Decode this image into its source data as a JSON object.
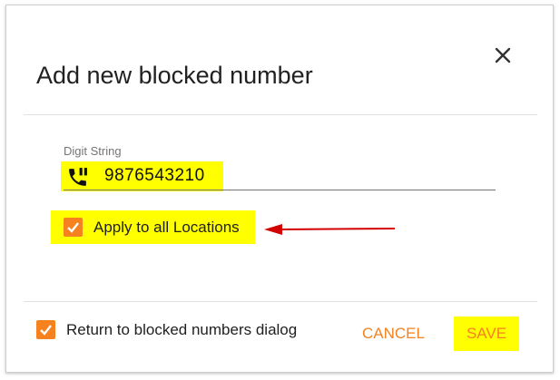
{
  "dialog": {
    "title": "Add new blocked number",
    "close_icon": "close-icon"
  },
  "digit_field": {
    "label": "Digit String",
    "value": "9876543210",
    "icon": "phone-forward-icon"
  },
  "apply_all": {
    "label": "Apply to all Locations",
    "checked": true
  },
  "footer": {
    "return_label": "Return to blocked numbers dialog",
    "return_checked": true,
    "cancel_label": "CANCEL",
    "save_label": "SAVE"
  },
  "colors": {
    "accent": "#f5821f",
    "highlight": "#ffff00",
    "annotation_arrow": "#d40000"
  }
}
